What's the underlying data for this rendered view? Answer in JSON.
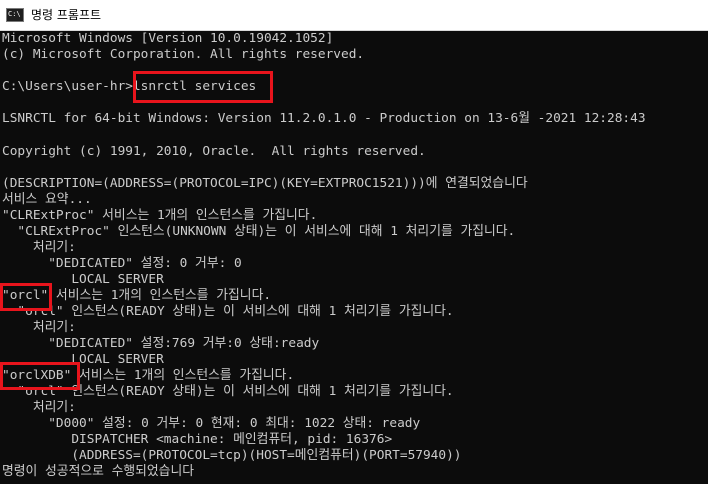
{
  "window": {
    "title": "명령 프롬프트",
    "icon": "cmd-icon",
    "icon_glyph": "C:\\"
  },
  "console": {
    "lines": [
      "Microsoft Windows [Version 10.0.19042.1052]",
      "(c) Microsoft Corporation. All rights reserved.",
      "",
      "C:\\Users\\user-hr>lsnrctl services",
      "",
      "LSNRCTL for 64-bit Windows: Version 11.2.0.1.0 - Production on 13-6월 -2021 12:28:43",
      "",
      "Copyright (c) 1991, 2010, Oracle.  All rights reserved.",
      "",
      "(DESCRIPTION=(ADDRESS=(PROTOCOL=IPC)(KEY=EXTPROC1521)))에 연결되었습니다",
      "서비스 요약...",
      "\"CLRExtProc\" 서비스는 1개의 인스턴스를 가집니다.",
      "  \"CLRExtProc\" 인스턴스(UNKNOWN 상태)는 이 서비스에 대해 1 처리기를 가집니다.",
      "    처리기:",
      "      \"DEDICATED\" 설정: 0 거부: 0",
      "         LOCAL SERVER",
      "\"orcl\" 서비스는 1개의 인스턴스를 가집니다.",
      "  \"orcl\" 인스턴스(READY 상태)는 이 서비스에 대해 1 처리기를 가집니다.",
      "    처리기:",
      "      \"DEDICATED\" 설정:769 거부:0 상태:ready",
      "         LOCAL SERVER",
      "\"orclXDB\" 서비스는 1개의 인스턴스를 가집니다.",
      "  \"orcl\" 인스턴스(READY 상태)는 이 서비스에 대해 1 처리기를 가집니다.",
      "    처리기:",
      "      \"D000\" 설정: 0 거부: 0 현재: 0 최대: 1022 상태: ready",
      "         DISPATCHER <machine: 메인컴퓨터, pid: 16376>",
      "         (ADDRESS=(PROTOCOL=tcp)(HOST=메인컴퓨터)(PORT=57940))",
      "명령이 성공적으로 수행되었습니다"
    ]
  },
  "colors": {
    "console_bg": "#0c0c0c",
    "console_text": "#cccccc",
    "highlight": "#e8141c",
    "titlebar_bg": "#ffffff"
  }
}
